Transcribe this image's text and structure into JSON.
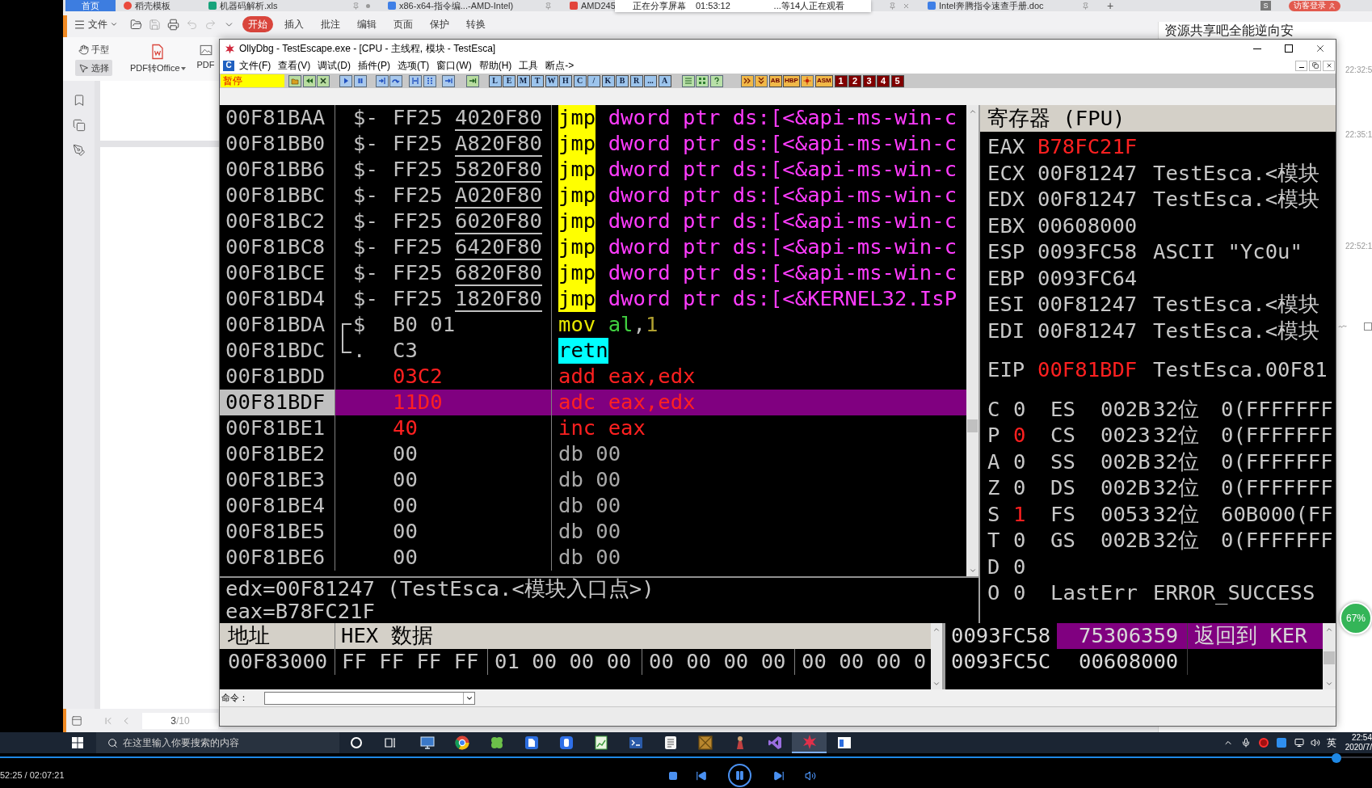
{
  "browser": {
    "tabs": [
      {
        "label": "首页",
        "kind": "home",
        "selected": true,
        "pinned": false,
        "modified": false,
        "closable": false
      },
      {
        "label": "稻壳模板",
        "kind": "template",
        "selected": false,
        "pinned": false,
        "modified": false,
        "closable": false
      },
      {
        "label": "机器码解析.xls",
        "kind": "sheet",
        "selected": false,
        "pinned": true,
        "modified": true,
        "closable": false
      },
      {
        "label": "x86-x64-指令编...-AMD-Intel)",
        "kind": "doc",
        "selected": false,
        "pinned": true,
        "modified": false,
        "closable": false
      },
      {
        "label": "AMD245",
        "kind": "pdf",
        "selected": false,
        "pinned": true,
        "modified": false,
        "closable": true
      },
      {
        "label": "Intel奔腾指令速查手册.doc",
        "kind": "doc",
        "selected": false,
        "pinned": true,
        "modified": false,
        "closable": false
      }
    ],
    "new_tab": "+",
    "account_badge": "S",
    "login": "访客登录"
  },
  "share_popup": {
    "status": "正在分享屏幕",
    "elapsed": "01:53:12",
    "viewers": "...等14人正在观看"
  },
  "wps_toolbar": {
    "menu": "文件",
    "tabs": [
      {
        "label": "开始",
        "selected": true
      },
      {
        "label": "插入",
        "selected": false
      },
      {
        "label": "批注",
        "selected": false
      },
      {
        "label": "编辑",
        "selected": false
      },
      {
        "label": "页面",
        "selected": false
      },
      {
        "label": "保护",
        "selected": false
      },
      {
        "label": "转换",
        "selected": false
      }
    ]
  },
  "wps_ribbon": {
    "tools": [
      {
        "label": "手型",
        "kind": "hand",
        "selected": false
      },
      {
        "label": "选择",
        "kind": "select",
        "selected": true
      }
    ],
    "buttons": [
      {
        "label": "PDF转Office",
        "kind": "convert",
        "dropdown": true
      },
      {
        "label": "PDF",
        "kind": "image",
        "dropdown": false
      }
    ]
  },
  "page_nav": {
    "current": "3",
    "total": "/10"
  },
  "comment_panel": {
    "title": "资源共享吧全能逆向安",
    "times": [
      "22:32:5",
      "22:35:1",
      "22:52:1"
    ]
  },
  "percent_badge": "67%",
  "ollydbg": {
    "title": "OllyDbg - TestEscape.exe - [CPU - 主线程, 模块 - TestEsca]",
    "child_badge": "C",
    "menu": [
      "文件(F)",
      "查看(V)",
      "调试(D)",
      "插件(P)",
      "选项(T)",
      "窗口(W)",
      "帮助(H)",
      "工具",
      "断点->"
    ],
    "toolbar": {
      "status": "暂停",
      "view_buttons": [
        "L",
        "E",
        "M",
        "T",
        "W",
        "H",
        "C",
        "/",
        "K",
        "B",
        "R",
        "...",
        "A"
      ],
      "trace_buttons": [
        "AB",
        "HBP",
        "ASM"
      ],
      "number_buttons": [
        "1",
        "2",
        "3",
        "4",
        "5"
      ]
    },
    "disassembly": {
      "rows": [
        {
          "address": "00F81BAA",
          "marker": "$-",
          "hex": "FF25",
          "fixup": "4020F80",
          "modified": false,
          "selected": false,
          "mnemonic": {
            "text": "jmp",
            "kind": "jump"
          },
          "operands": [
            {
              "text": "dword ptr ds:[<&api-ms-win-c",
              "kind": "import"
            }
          ]
        },
        {
          "address": "00F81BB0",
          "marker": "$-",
          "hex": "FF25",
          "fixup": "A820F80",
          "modified": false,
          "selected": false,
          "mnemonic": {
            "text": "jmp",
            "kind": "jump"
          },
          "operands": [
            {
              "text": "dword ptr ds:[<&api-ms-win-c",
              "kind": "import"
            }
          ]
        },
        {
          "address": "00F81BB6",
          "marker": "$-",
          "hex": "FF25",
          "fixup": "5820F80",
          "modified": false,
          "selected": false,
          "mnemonic": {
            "text": "jmp",
            "kind": "jump"
          },
          "operands": [
            {
              "text": "dword ptr ds:[<&api-ms-win-c",
              "kind": "import"
            }
          ]
        },
        {
          "address": "00F81BBC",
          "marker": "$-",
          "hex": "FF25",
          "fixup": "A020F80",
          "modified": false,
          "selected": false,
          "mnemonic": {
            "text": "jmp",
            "kind": "jump"
          },
          "operands": [
            {
              "text": "dword ptr ds:[<&api-ms-win-c",
              "kind": "import"
            }
          ]
        },
        {
          "address": "00F81BC2",
          "marker": "$-",
          "hex": "FF25",
          "fixup": "6020F80",
          "modified": false,
          "selected": false,
          "mnemonic": {
            "text": "jmp",
            "kind": "jump"
          },
          "operands": [
            {
              "text": "dword ptr ds:[<&api-ms-win-c",
              "kind": "import"
            }
          ]
        },
        {
          "address": "00F81BC8",
          "marker": "$-",
          "hex": "FF25",
          "fixup": "6420F80",
          "modified": false,
          "selected": false,
          "mnemonic": {
            "text": "jmp",
            "kind": "jump"
          },
          "operands": [
            {
              "text": "dword ptr ds:[<&api-ms-win-c",
              "kind": "import"
            }
          ]
        },
        {
          "address": "00F81BCE",
          "marker": "$-",
          "hex": "FF25",
          "fixup": "6820F80",
          "modified": false,
          "selected": false,
          "mnemonic": {
            "text": "jmp",
            "kind": "jump"
          },
          "operands": [
            {
              "text": "dword ptr ds:[<&api-ms-win-c",
              "kind": "import"
            }
          ]
        },
        {
          "address": "00F81BD4",
          "marker": "$-",
          "hex": "FF25",
          "fixup": "1820F80",
          "modified": false,
          "selected": false,
          "mnemonic": {
            "text": "jmp",
            "kind": "jump"
          },
          "operands": [
            {
              "text": "dword ptr ds:[<&KERNEL32.IsP",
              "kind": "import"
            }
          ]
        },
        {
          "address": "00F81BDA",
          "marker": "$",
          "bracket": {
            "kind": "start"
          },
          "hex": "B0 01",
          "modified": false,
          "selected": false,
          "mnemonic": {
            "text": "mov",
            "kind": "move"
          },
          "operands": [
            {
              "text": "al",
              "kind": "register"
            },
            {
              "text": ",",
              "kind": "plain"
            },
            {
              "text": "1",
              "kind": "constant"
            }
          ]
        },
        {
          "address": "00F81BDC",
          "marker": ".",
          "bracket": {
            "kind": "end"
          },
          "hex": "C3",
          "modified": false,
          "selected": false,
          "mnemonic": {
            "text": "retn",
            "kind": "return"
          }
        },
        {
          "address": "00F81BDD",
          "hex": "03C2",
          "modified": true,
          "selected": false,
          "mnemonic": {
            "text": "add",
            "kind": "arith"
          },
          "operands": [
            {
              "text": "eax,edx",
              "kind": "arith"
            }
          ]
        },
        {
          "address": "00F81BDF",
          "hex": "11D0",
          "modified": true,
          "selected": true,
          "mnemonic": {
            "text": "adc",
            "kind": "arith"
          },
          "operands": [
            {
              "text": "eax,edx",
              "kind": "arith"
            }
          ]
        },
        {
          "address": "00F81BE1",
          "hex": "40",
          "modified": true,
          "selected": false,
          "mnemonic": {
            "text": "inc",
            "kind": "arith"
          },
          "operands": [
            {
              "text": "eax",
              "kind": "arith"
            }
          ]
        },
        {
          "address": "00F81BE2",
          "hex": "00",
          "modified": false,
          "selected": false,
          "mnemonic": {
            "text": "db",
            "kind": "data"
          },
          "operands": [
            {
              "text": "00",
              "kind": "data"
            }
          ]
        },
        {
          "address": "00F81BE3",
          "hex": "00",
          "modified": false,
          "selected": false,
          "mnemonic": {
            "text": "db",
            "kind": "data"
          },
          "operands": [
            {
              "text": "00",
              "kind": "data"
            }
          ]
        },
        {
          "address": "00F81BE4",
          "hex": "00",
          "modified": false,
          "selected": false,
          "mnemonic": {
            "text": "db",
            "kind": "data"
          },
          "operands": [
            {
              "text": "00",
              "kind": "data"
            }
          ]
        },
        {
          "address": "00F81BE5",
          "hex": "00",
          "modified": false,
          "selected": false,
          "mnemonic": {
            "text": "db",
            "kind": "data"
          },
          "operands": [
            {
              "text": "00",
              "kind": "data"
            }
          ]
        },
        {
          "address": "00F81BE6",
          "hex": "00",
          "modified": false,
          "selected": false,
          "mnemonic": {
            "text": "db",
            "kind": "data"
          },
          "operands": [
            {
              "text": "00",
              "kind": "data"
            }
          ]
        }
      ]
    },
    "info": [
      "edx=00F81247 (TestEsca.<模块入口点>)",
      "eax=B78FC21F"
    ],
    "registers": {
      "title": "寄存器 (FPU)",
      "general": [
        {
          "name": "EAX",
          "value": "B78FC21F",
          "changed": true
        },
        {
          "name": "ECX",
          "value": "00F81247",
          "changed": false,
          "comment": "TestEsca.<模块"
        },
        {
          "name": "EDX",
          "value": "00F81247",
          "changed": false,
          "comment": "TestEsca.<模块"
        },
        {
          "name": "EBX",
          "value": "00608000",
          "changed": false
        },
        {
          "name": "ESP",
          "value": "0093FC58",
          "changed": false,
          "comment": "ASCII \"Yc0u\""
        },
        {
          "name": "EBP",
          "value": "0093FC64",
          "changed": false
        },
        {
          "name": "ESI",
          "value": "00F81247",
          "changed": false,
          "comment": "TestEsca.<模块"
        },
        {
          "name": "EDI",
          "value": "00F81247",
          "changed": false,
          "comment": "TestEsca.<模块"
        }
      ],
      "eip": {
        "name": "EIP",
        "value": "00F81BDF",
        "changed": true,
        "comment": "TestEsca.00F81"
      },
      "flags": [
        {
          "name": "C",
          "value": "0",
          "changed": false,
          "segment": "ES",
          "selector": "002B",
          "bits": "32位",
          "base": "0(FFFFFFF"
        },
        {
          "name": "P",
          "value": "0",
          "changed": true,
          "segment": "CS",
          "selector": "0023",
          "bits": "32位",
          "base": "0(FFFFFFF"
        },
        {
          "name": "A",
          "value": "0",
          "changed": false,
          "segment": "SS",
          "selector": "002B",
          "bits": "32位",
          "base": "0(FFFFFFF"
        },
        {
          "name": "Z",
          "value": "0",
          "changed": false,
          "segment": "DS",
          "selector": "002B",
          "bits": "32位",
          "base": "0(FFFFFFF"
        },
        {
          "name": "S",
          "value": "1",
          "changed": true,
          "segment": "FS",
          "selector": "0053",
          "bits": "32位",
          "base": "60B000(FF"
        },
        {
          "name": "T",
          "value": "0",
          "changed": false,
          "segment": "GS",
          "selector": "002B",
          "bits": "32位",
          "base": "0(FFFFFFF"
        },
        {
          "name": "D",
          "value": "0",
          "changed": false
        },
        {
          "name": "O",
          "value": "0",
          "changed": false,
          "label": "LastErr",
          "detail": "ERROR_SUCCESS"
        }
      ]
    },
    "dump": {
      "columns": [
        "地址",
        "HEX 数据"
      ],
      "rows": [
        {
          "address": "00F83000",
          "groups": [
            "FF FF FF FF",
            "01 00 00 00",
            "00 00 00 00",
            "00 00 00 0"
          ]
        }
      ]
    },
    "stack": {
      "rows": [
        {
          "address": "0093FC58",
          "value": "75306359",
          "comment": "返回到 KER",
          "selected": true
        },
        {
          "address": "0093FC5C",
          "value": "00608000",
          "selected": false
        }
      ]
    },
    "command": {
      "label": "命令："
    }
  },
  "taskbar": {
    "search": {
      "placeholder": "在这里输入你要搜索的内容"
    },
    "apps": [
      {
        "kind": "monitor",
        "active": false
      },
      {
        "kind": "ring",
        "active": false
      },
      {
        "kind": "clover",
        "active": false
      },
      {
        "kind": "tile",
        "active": false
      },
      {
        "kind": "bubble",
        "active": false
      },
      {
        "kind": "chart",
        "active": false
      },
      {
        "kind": "terminal",
        "active": false
      },
      {
        "kind": "page",
        "active": false
      },
      {
        "kind": "crate",
        "active": false
      },
      {
        "kind": "figure",
        "active": false
      },
      {
        "kind": "ribbon",
        "active": false
      },
      {
        "kind": "starburst",
        "active": true
      },
      {
        "kind": "window",
        "active": false
      }
    ],
    "language": "英",
    "time": "22:54",
    "date": "2020/7/"
  },
  "video_player": {
    "time": "52:25 / 02:07:21",
    "level": 0.974
  }
}
